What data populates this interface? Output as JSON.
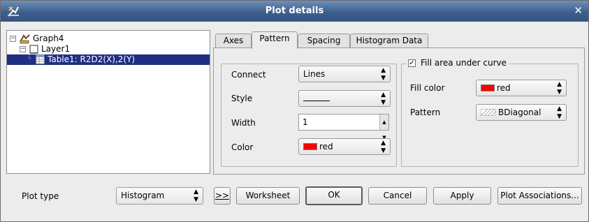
{
  "window": {
    "title": "Plot details"
  },
  "tree": {
    "items": [
      {
        "label": "Graph4"
      },
      {
        "label": "Layer1"
      },
      {
        "label": "Table1: R2D2(X),2(Y)"
      }
    ]
  },
  "tabs": [
    {
      "label": "Axes"
    },
    {
      "label": "Pattern"
    },
    {
      "label": "Spacing"
    },
    {
      "label": "Histogram Data"
    }
  ],
  "line_group": {
    "connect_label": "Connect",
    "connect_value": "Lines",
    "style_label": "Style",
    "width_label": "Width",
    "width_value": "1",
    "color_label": "Color",
    "color_value": "red",
    "color_hex": "#ff0000"
  },
  "fill_group": {
    "checkbox_label": "Fill area under curve",
    "checked": true,
    "fill_color_label": "Fill color",
    "fill_color_value": "red",
    "fill_color_hex": "#ff0000",
    "pattern_label": "Pattern",
    "pattern_value": "BDiagonal"
  },
  "footer": {
    "plot_type_label": "Plot type",
    "plot_type_value": "Histogram",
    "expand_label": ">>",
    "worksheet_label": "Worksheet",
    "ok_label": "OK",
    "cancel_label": "Cancel",
    "apply_label": "Apply",
    "plot_assoc_label": "Plot Associations..."
  }
}
